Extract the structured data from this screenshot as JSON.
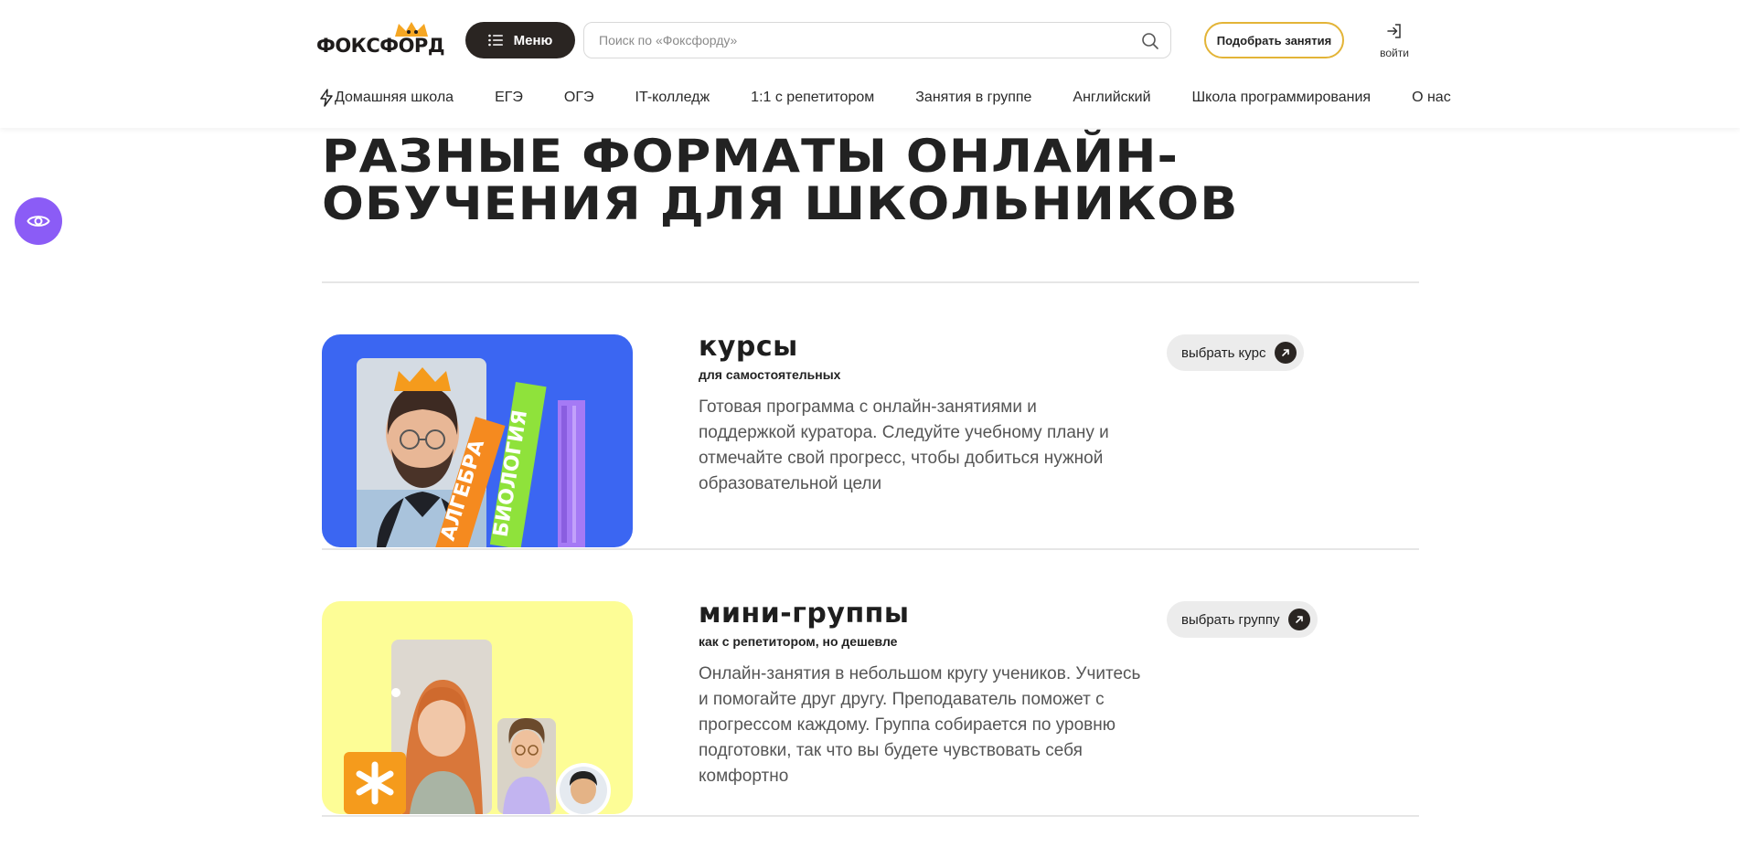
{
  "header": {
    "logo_text": "ФОКСФОРД",
    "menu_label": "Меню",
    "search_placeholder": "Поиск по «Фоксфорду»",
    "pick_label": "Подобрать занятия",
    "login_label": "войти"
  },
  "nav": {
    "items": [
      {
        "label": "Домашняя школа"
      },
      {
        "label": "ЕГЭ"
      },
      {
        "label": "ОГЭ"
      },
      {
        "label": "IT-колледж"
      },
      {
        "label": "1:1 с репетитором"
      },
      {
        "label": "Занятия в группе"
      },
      {
        "label": "Английский"
      },
      {
        "label": "Школа программирования"
      },
      {
        "label": "О нас"
      }
    ]
  },
  "main": {
    "title_line1": "РАЗНЫЕ ФОРМАТЫ ОНЛАЙН-",
    "title_line2": "ОБУЧЕНИЯ ДЛЯ ШКОЛЬНИКОВ",
    "cards": [
      {
        "title": "курсы",
        "subtitle": "для самостоятельных",
        "description": "Готовая программа с онлайн-занятиями и поддержкой куратора. Следуйте учебному плану и отмечайте свой прогресс, чтобы добиться нужной образовательной цели",
        "button": "выбрать курс",
        "book_labels": [
          "АЛГЕБРА",
          "БИОЛОГИЯ"
        ]
      },
      {
        "title": "мини-группы",
        "subtitle": "как с репетитором, но дешевле",
        "description": "Онлайн-занятия в небольшом кругу учеников. Учитесь и помогайте друг другу. Преподаватель поможет с прогрессом каждому. Группа собирается по уровню подготовки, так что вы будете чувствовать себя комфортно",
        "button": "выбрать группу"
      }
    ]
  },
  "colors": {
    "accent_yellow": "#e3b437",
    "dark": "#2a2522",
    "purple": "#8b5cf6",
    "card1_bg": "#3b66f2",
    "card2_bg": "#fdfd96"
  }
}
